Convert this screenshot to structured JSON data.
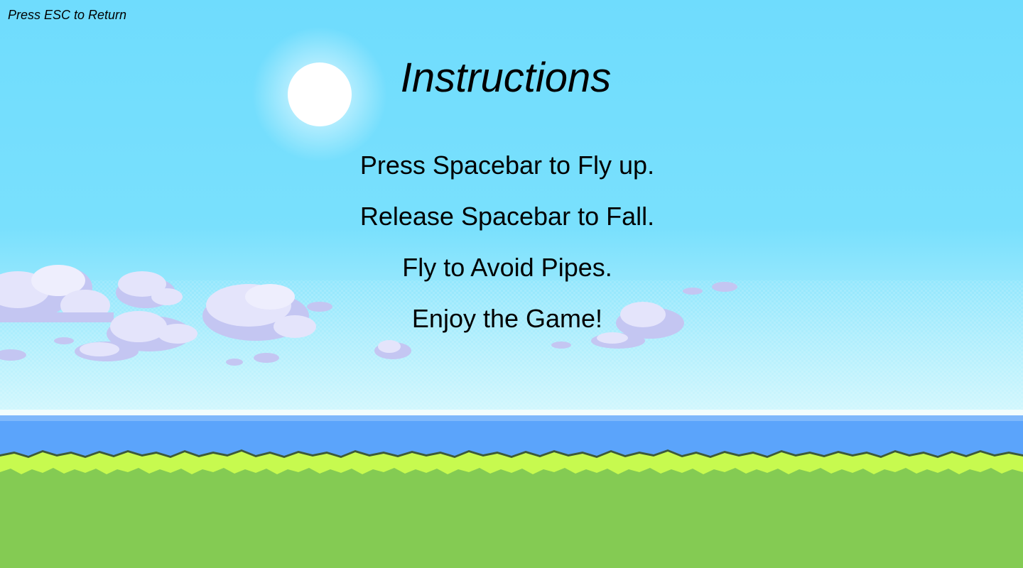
{
  "hud": {
    "escape_hint": "Press ESC to Return"
  },
  "screen": {
    "title": "Instructions",
    "instructions": [
      "Press Spacebar to Fly up.",
      "Release Spacebar to Fall.",
      "Fly to Avoid Pipes.",
      "Enjoy the Game!"
    ]
  },
  "background": {
    "elements": [
      "sky",
      "sun",
      "clouds",
      "sea",
      "grass"
    ],
    "colors": {
      "sky_top": "#6fdcfd",
      "sky_horizon": "#c6f4fd",
      "sun": "#ffffff",
      "cloud": "#e4e4fb",
      "cloud_shadow": "#c4c6f2",
      "sea": "#5ba4fb",
      "grass_light": "#c7fa4f",
      "grass": "#84cb53"
    }
  }
}
